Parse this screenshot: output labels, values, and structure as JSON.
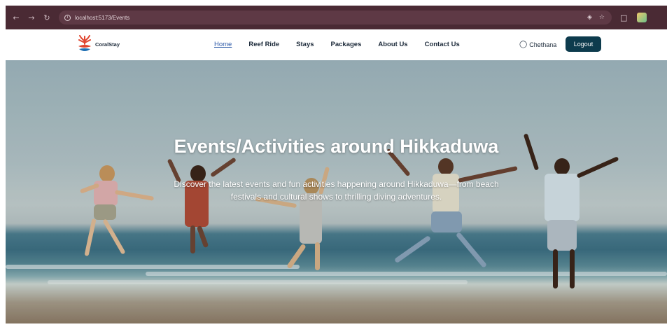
{
  "browser": {
    "url": "localhost:5173/Events",
    "back_icon": "arrow-left",
    "forward_icon": "arrow-right",
    "reload_icon": "reload"
  },
  "header": {
    "logo_text": "CoralStay",
    "nav": [
      {
        "label": "Home",
        "active": true
      },
      {
        "label": "Reef Ride",
        "active": false
      },
      {
        "label": "Stays",
        "active": false
      },
      {
        "label": "Packages",
        "active": false
      },
      {
        "label": "About Us",
        "active": false
      },
      {
        "label": "Contact Us",
        "active": false
      }
    ],
    "user_name": "Chethana",
    "logout_label": "Logout"
  },
  "hero": {
    "title": "Events/Activities around Hikkaduwa",
    "subtitle": "Discover the latest events and fun activities happening around Hikkaduwa—from beach festivals and cultural shows to thrilling diving adventures."
  },
  "colors": {
    "browser_bar": "#4a2a34",
    "logout_button": "#0d3b4d",
    "active_nav": "#2e5aa8"
  }
}
